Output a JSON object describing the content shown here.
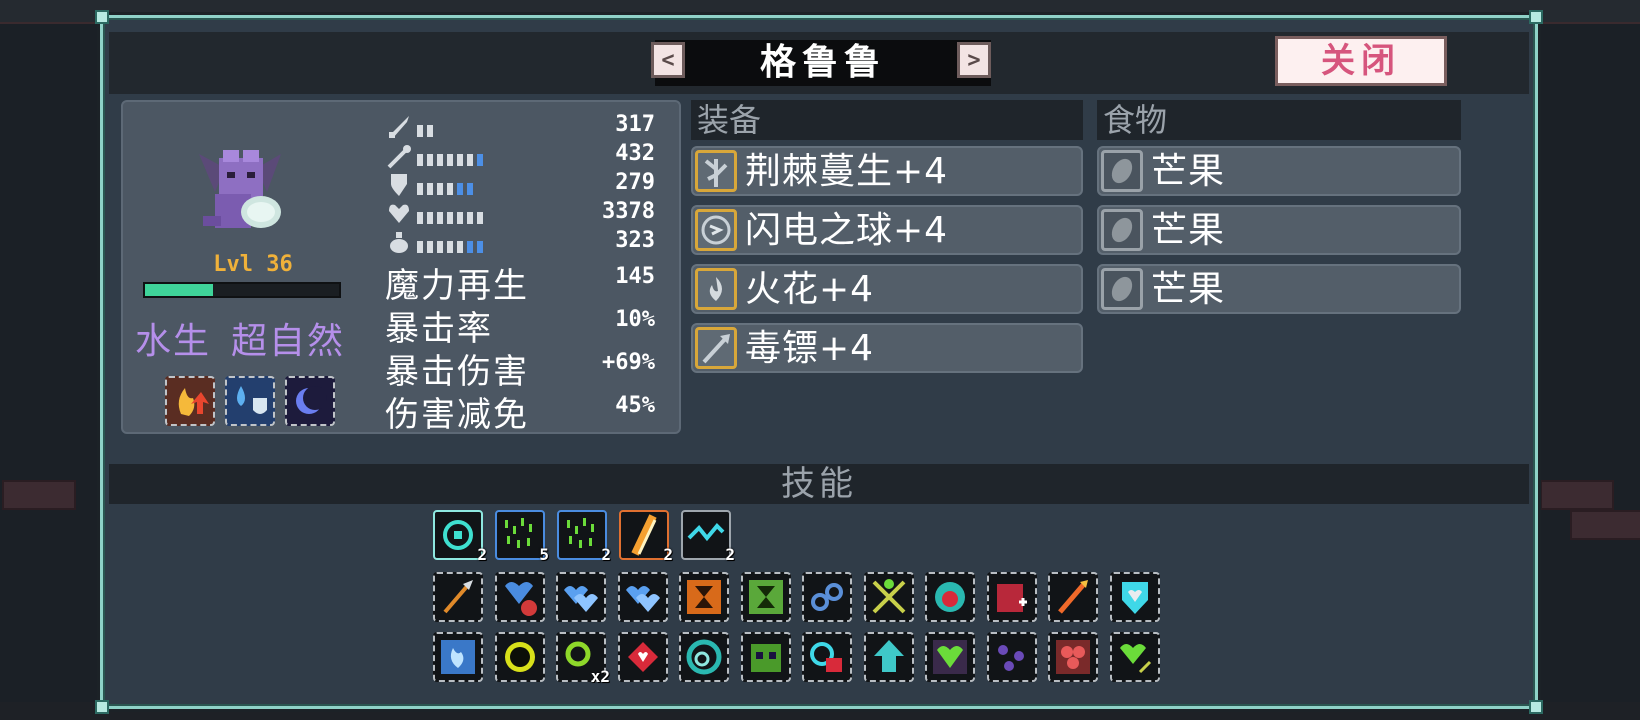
{
  "title": "格鲁鲁",
  "nav": {
    "prev_label": "<",
    "next_label": ">"
  },
  "close_label": "关闭",
  "monster": {
    "level": "Lvl 36",
    "xp_fraction": 0.35,
    "types": [
      "水生",
      "超自然"
    ]
  },
  "stats": [
    {
      "icon": "sword-icon",
      "value": "317",
      "white_pips": 2,
      "blue_pips": 0
    },
    {
      "icon": "wand-icon",
      "value": "432",
      "white_pips": 6,
      "blue_pips": 1
    },
    {
      "icon": "shield-icon",
      "value": "279",
      "white_pips": 4,
      "blue_pips": 2
    },
    {
      "icon": "heart-icon",
      "value": "3378",
      "white_pips": 7,
      "blue_pips": 0
    },
    {
      "icon": "mana-flask-icon",
      "value": "323",
      "white_pips": 5,
      "blue_pips": 2
    }
  ],
  "big_stats": [
    {
      "label": "魔力再生",
      "value": "145"
    },
    {
      "label": "暴击率",
      "value": "10%"
    },
    {
      "label": "暴击伤害",
      "value": "+69%"
    },
    {
      "label": "伤害减免",
      "value": "45%"
    }
  ],
  "equipment": {
    "header": "装备",
    "items": [
      {
        "name": "荆棘蔓生+4",
        "icon": "thorn-vine-icon"
      },
      {
        "name": "闪电之球+4",
        "icon": "lightning-orb-icon"
      },
      {
        "name": "火花+4",
        "icon": "spark-icon"
      },
      {
        "name": "毒镖+4",
        "icon": "poison-dart-icon"
      }
    ]
  },
  "food": {
    "header": "食物",
    "items": [
      {
        "name": "芒果",
        "icon": "mango-icon"
      },
      {
        "name": "芒果",
        "icon": "mango-icon"
      },
      {
        "name": "芒果",
        "icon": "mango-icon"
      }
    ]
  },
  "skills_header": "技能",
  "skill_row1": [
    {
      "icon": "crosshair-orb-icon",
      "count": "2",
      "border": "#8ee8e0"
    },
    {
      "icon": "green-rain-icon",
      "count": "5",
      "border": "#4a8ce0"
    },
    {
      "icon": "green-rain-icon",
      "count": "2",
      "border": "#4a8ce0"
    },
    {
      "icon": "fire-slash-icon",
      "count": "2",
      "border": "#e07030"
    },
    {
      "icon": "lightning-wave-icon",
      "count": "2",
      "border": "#9ea6ad"
    }
  ],
  "skill_row2": [
    "dagger-icon",
    "heart-shield-icon",
    "blue-hearts-icon",
    "blue-hearts-icon",
    "orange-hourglass-icon",
    "green-hourglass-icon",
    "chain-link-icon",
    "crossed-wands-icon",
    "skull-orb-icon",
    "red-hand-icon",
    "fire-dagger-icon",
    "heart-badge-icon"
  ],
  "skill_row3": [
    {
      "icon": "blue-flame-icon",
      "count": ""
    },
    {
      "icon": "black-sun-icon",
      "count": ""
    },
    {
      "icon": "green-ring-icon",
      "count": "x2"
    },
    {
      "icon": "red-gem-icon",
      "count": ""
    },
    {
      "icon": "vortex-icon",
      "count": ""
    },
    {
      "icon": "demon-face-icon",
      "count": ""
    },
    {
      "icon": "lock-eye-icon",
      "count": ""
    },
    {
      "icon": "up-arrow-icon",
      "count": ""
    },
    {
      "icon": "green-heart-icon",
      "count": ""
    },
    {
      "icon": "purple-orbs-icon",
      "count": ""
    },
    {
      "icon": "red-petals-icon",
      "count": ""
    },
    {
      "icon": "heart-arrow-icon",
      "count": ""
    }
  ],
  "colors": {
    "panel_border": "#8fd2c8",
    "level_text": "#f0b13a",
    "type_text": "#b58fea",
    "close_text": "#d6557d",
    "equip_frame": "#d8a73a"
  }
}
